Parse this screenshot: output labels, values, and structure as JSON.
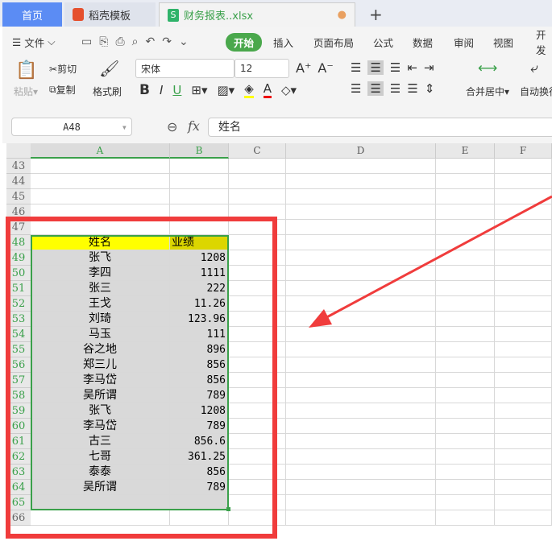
{
  "tabs": [
    {
      "label": "首页"
    },
    {
      "label": "稻壳模板"
    },
    {
      "label": "财务报表..xlsx"
    }
  ],
  "menu": [
    "文件",
    "开始",
    "插入",
    "页面布局",
    "公式",
    "数据",
    "审阅",
    "视图",
    "开发"
  ],
  "ribbon": {
    "paste": "粘贴",
    "cut": "剪切",
    "copy": "复制",
    "format_painter": "格式刷",
    "font": "宋体",
    "size": "12",
    "merge": "合并居中",
    "wrap": "自动换行"
  },
  "formula_bar": {
    "cell_ref": "A48",
    "fx": "fx",
    "value": "姓名"
  },
  "columns": [
    "A",
    "B",
    "C",
    "D",
    "E",
    "F"
  ],
  "rows_before": [
    "43",
    "44",
    "45",
    "46",
    "47"
  ],
  "header": {
    "row": "48",
    "a": "姓名",
    "b": "业绩"
  },
  "data": [
    {
      "row": "49",
      "name": "张飞",
      "value": "1208"
    },
    {
      "row": "50",
      "name": "李四",
      "value": "1111"
    },
    {
      "row": "51",
      "name": "张三",
      "value": "222"
    },
    {
      "row": "52",
      "name": "王戈",
      "value": "11.26"
    },
    {
      "row": "53",
      "name": "刘琦",
      "value": "123.96"
    },
    {
      "row": "54",
      "name": "马玉",
      "value": "111"
    },
    {
      "row": "55",
      "name": "谷之地",
      "value": "896"
    },
    {
      "row": "56",
      "name": "郑三儿",
      "value": "856"
    },
    {
      "row": "57",
      "name": "李马岱",
      "value": "856"
    },
    {
      "row": "58",
      "name": "吴所谓",
      "value": "789"
    },
    {
      "row": "59",
      "name": "张飞",
      "value": "1208"
    },
    {
      "row": "60",
      "name": "李马岱",
      "value": "789"
    },
    {
      "row": "61",
      "name": "古三",
      "value": "856.6"
    },
    {
      "row": "62",
      "name": "七哥",
      "value": "361.25"
    },
    {
      "row": "63",
      "name": "泰泰",
      "value": "856"
    },
    {
      "row": "64",
      "name": "吴所谓",
      "value": "789"
    }
  ],
  "rows_after": [
    "65",
    "66"
  ],
  "colors": {
    "accent": "#4aa84c",
    "highlight": "#ffff00",
    "annotation": "#f03c3c"
  }
}
